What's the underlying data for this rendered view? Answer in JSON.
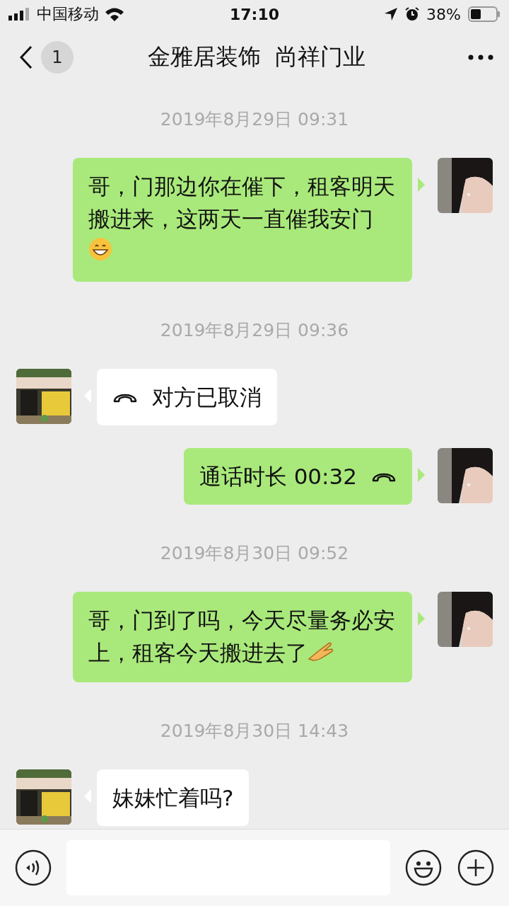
{
  "status_bar": {
    "carrier": "中国移动",
    "time": "17:10",
    "battery": "38%"
  },
  "nav": {
    "unread": "1",
    "title": "金雅居装饰  尚祥门业"
  },
  "items": [
    {
      "kind": "time",
      "text": "2019年8月29日 09:31"
    },
    {
      "kind": "sent",
      "text": "哥，门那边你在催下，租客明天搬进来，这两天一直催我安门",
      "icons": [
        {
          "kind": "grin"
        }
      ]
    },
    {
      "kind": "time",
      "text": "2019年8月29日 09:36"
    },
    {
      "kind": "received_call",
      "text": "对方已取消"
    },
    {
      "kind": "sent_call",
      "text": "通话时长 00:32"
    },
    {
      "kind": "time",
      "text": "2019年8月30日 09:52"
    },
    {
      "kind": "sent",
      "text": "哥，门到了吗，今天尽量务必安上，租客今天搬进去了",
      "icons": [
        {
          "kind": "hand"
        }
      ]
    },
    {
      "kind": "time",
      "text": "2019年8月30日 14:43"
    },
    {
      "kind": "received",
      "text": "妹妹忙着吗?"
    }
  ]
}
